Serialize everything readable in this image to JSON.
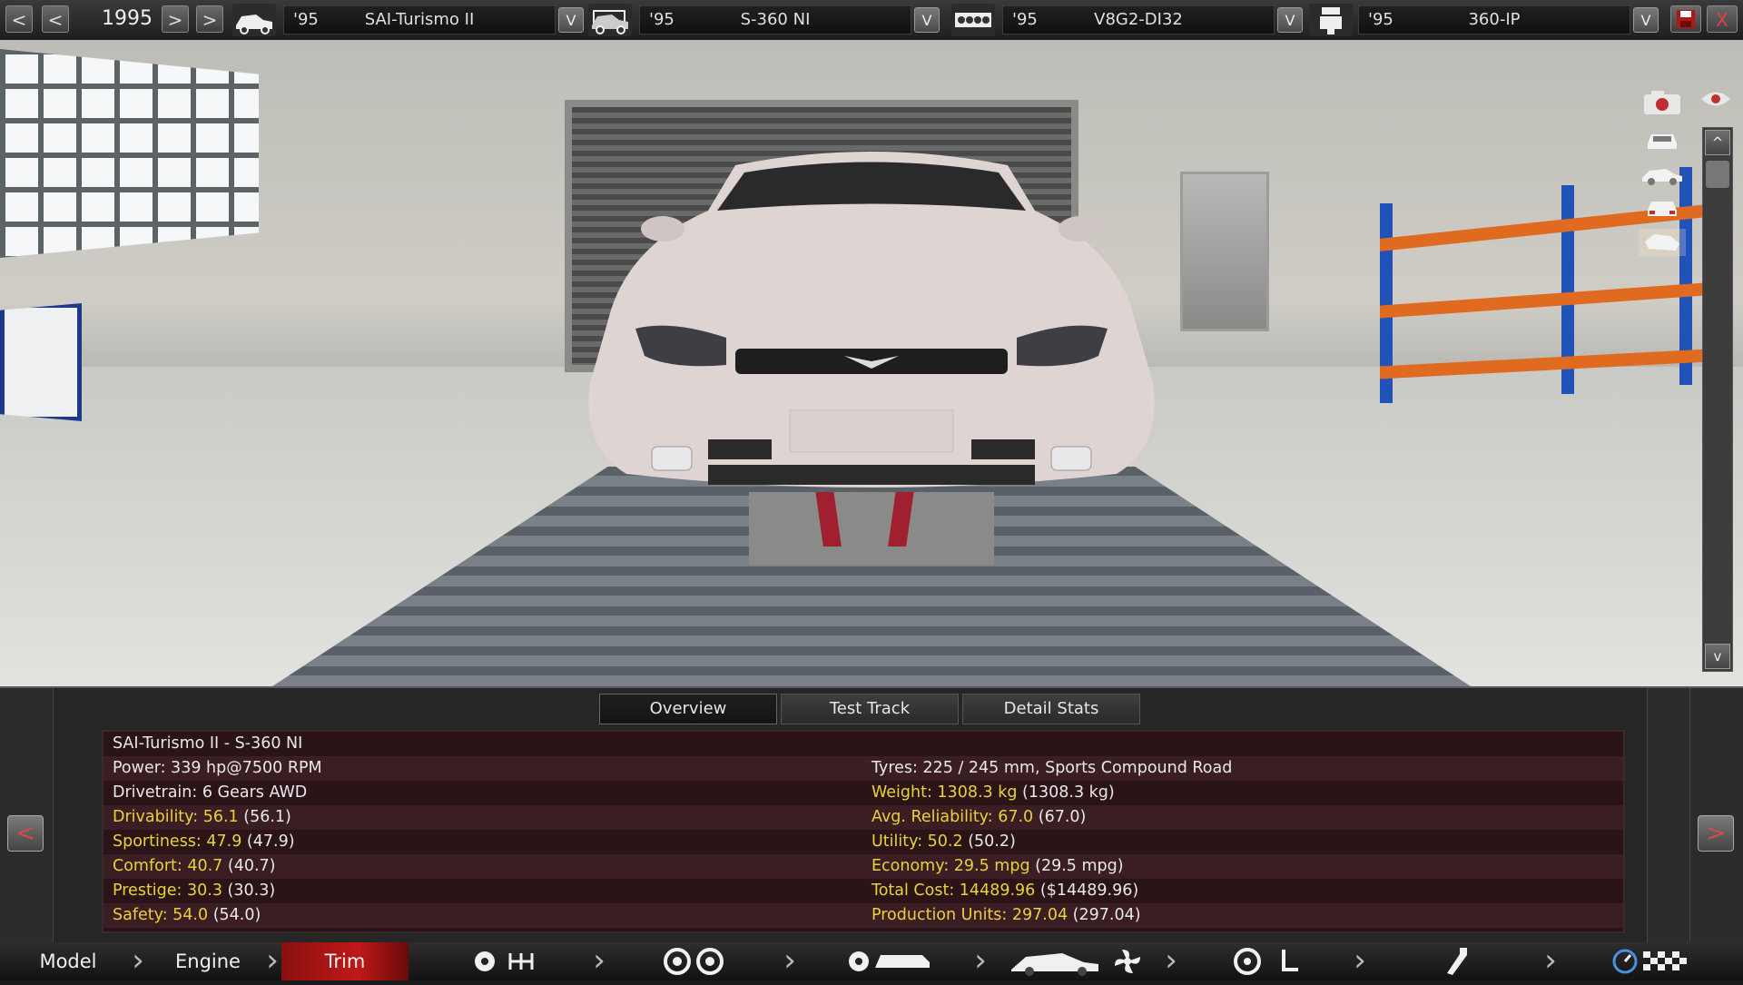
{
  "topbar": {
    "prev_far_label": "<",
    "prev_label": "<",
    "year": "1995",
    "next_label": ">",
    "next_far_label": ">",
    "fields": [
      {
        "year": "'95",
        "name": "SAI-Turismo II",
        "drop": "V"
      },
      {
        "year": "'95",
        "name": "S-360 NI",
        "drop": "V"
      },
      {
        "year": "'95",
        "name": "V8G2-DI32",
        "drop": "V"
      },
      {
        "year": "'95",
        "name": "360-IP",
        "drop": "V"
      }
    ],
    "close_label": "X"
  },
  "viewport": {
    "scroll_up": "^",
    "scroll_down": "v"
  },
  "tabs": [
    {
      "label": "Overview",
      "active": true
    },
    {
      "label": "Test Track",
      "active": false
    },
    {
      "label": "Detail Stats",
      "active": false
    }
  ],
  "stats": {
    "left": [
      {
        "label": "SAI-Turismo II - S-360 NI",
        "value": "",
        "color": "white"
      },
      {
        "label": "Power: 339 hp@7500 RPM",
        "value": "",
        "color": "white"
      },
      {
        "label": "Drivetrain: 6 Gears AWD",
        "value": "",
        "color": "white"
      },
      {
        "label": "Drivability: 56.1",
        "value": " (56.1)",
        "color": "yellow"
      },
      {
        "label": "Sportiness: 47.9",
        "value": " (47.9)",
        "color": "yellow"
      },
      {
        "label": "Comfort: 40.7",
        "value": " (40.7)",
        "color": "yellow"
      },
      {
        "label": "Prestige: 30.3",
        "value": " (30.3)",
        "color": "yellow"
      },
      {
        "label": "Safety: 54.0",
        "value": " (54.0)",
        "color": "yellow"
      }
    ],
    "right": [
      {
        "label": "",
        "value": "",
        "color": "white"
      },
      {
        "label": "Tyres: 225 / 245 mm, Sports Compound Road",
        "value": "",
        "color": "white"
      },
      {
        "label": "Weight: 1308.3 kg",
        "value": " (1308.3 kg)",
        "color": "yellow"
      },
      {
        "label": "Avg. Reliability: 67.0",
        "value": " (67.0)",
        "color": "yellow"
      },
      {
        "label": "Utility: 50.2",
        "value": " (50.2)",
        "color": "yellow"
      },
      {
        "label": "Economy: 29.5 mpg",
        "value": " (29.5 mpg)",
        "color": "yellow"
      },
      {
        "label": "Total Cost: 14489.96",
        "value": " ($14489.96)",
        "color": "yellow"
      },
      {
        "label": "Production Units: 297.04",
        "value": " (297.04)",
        "color": "yellow"
      }
    ]
  },
  "panel": {
    "left_arrow": "<",
    "right_arrow": ">"
  },
  "bottom_nav": {
    "model": "Model",
    "engine": "Engine",
    "trim": "Trim"
  },
  "colors": {
    "accent_red": "#c01818",
    "stat_yellow": "#e8d23a",
    "stat_bg": "#2a1418",
    "stat_row_alt": "#3a1e24"
  }
}
